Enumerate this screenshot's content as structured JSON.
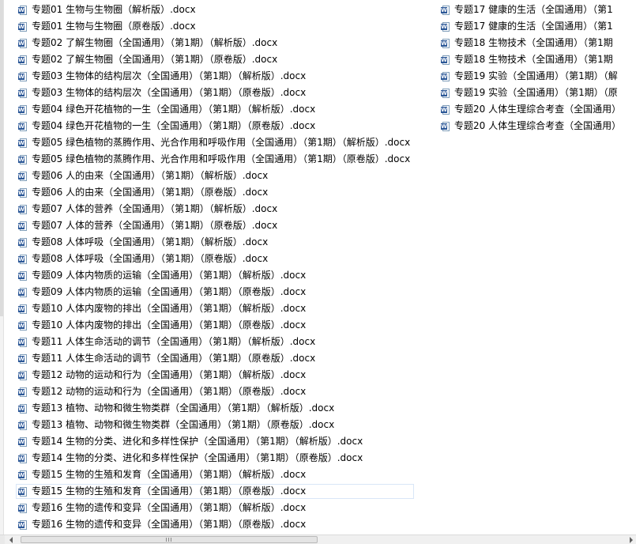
{
  "icons": {
    "file_icon": "word-doc-icon",
    "badge_letter": "W"
  },
  "colors": {
    "badge": "#2b5797",
    "selection_border": "#d9e6f7"
  },
  "selected_index": 29,
  "files_left": [
    "专题01 生物与生物圈（解析版）.docx",
    "专题01 生物与生物圈（原卷版）.docx",
    "专题02 了解生物圈（全国通用）（第1期）（解析版）.docx",
    "专题02 了解生物圈（全国通用）（第1期）（原卷版）.docx",
    "专题03 生物体的结构层次（全国通用）（第1期）（解析版）.docx",
    "专题03 生物体的结构层次（全国通用）（第1期）（原卷版）.docx",
    "专题04 绿色开花植物的一生（全国通用）（第1期）（解析版）.docx",
    "专题04 绿色开花植物的一生（全国通用）（第1期）（原卷版）.docx",
    "专题05 绿色植物的蒸腾作用、光合作用和呼吸作用（全国通用）（第1期）（解析版）.docx",
    "专题05 绿色植物的蒸腾作用、光合作用和呼吸作用（全国通用）（第1期）（原卷版）.docx",
    "专题06 人的由来（全国通用）（第1期）（解析版）.docx",
    "专题06 人的由来（全国通用）（第1期）（原卷版）.docx",
    "专题07 人体的营养（全国通用）（第1期）（解析版）.docx",
    "专题07 人体的营养（全国通用）（第1期）（原卷版）.docx",
    "专题08 人体呼吸（全国通用）（第1期）（解析版）.docx",
    "专题08 人体呼吸（全国通用）（第1期）（原卷版）.docx",
    "专题09 人体内物质的运输（全国通用）（第1期）（解析版）.docx",
    "专题09 人体内物质的运输（全国通用）（第1期）（原卷版）.docx",
    "专题10 人体内废物的排出（全国通用）（第1期）（解析版）.docx",
    "专题10 人体内废物的排出（全国通用）（第1期）（原卷版）.docx",
    "专题11 人体生命活动的调节（全国通用）（第1期）（解析版）.docx",
    "专题11 人体生命活动的调节（全国通用）（第1期）（原卷版）.docx",
    "专题12 动物的运动和行为（全国通用）（第1期）（解析版）.docx",
    "专题12 动物的运动和行为（全国通用）（第1期）（原卷版）.docx",
    "专题13 植物、动物和微生物类群（全国通用）（第1期）（解析版）.docx",
    "专题13 植物、动物和微生物类群（全国通用）（第1期）（原卷版）.docx",
    "专题14 生物的分类、进化和多样性保护（全国通用）（第1期）（解析版）.docx",
    "专题14 生物的分类、进化和多样性保护（全国通用）（第1期）（原卷版）.docx",
    "专题15 生物的生殖和发育（全国通用）（第1期）（解析版）.docx",
    "专题15 生物的生殖和发育（全国通用）（第1期）（原卷版）.docx",
    "专题16 生物的遗传和变异（全国通用）（第1期）（解析版）.docx",
    "专题16 生物的遗传和变异（全国通用）（第1期）（原卷版）.docx"
  ],
  "files_right": [
    "专题17 健康的生活（全国通用）（第1",
    "专题17 健康的生活（全国通用）（第1",
    "专题18 生物技术（全国通用）（第1期",
    "专题18 生物技术（全国通用）（第1期",
    "专题19 实验（全国通用）（第1期）（解",
    "专题19 实验（全国通用）（第1期）（原",
    "专题20 人体生理综合考查（全国通用）",
    "专题20 人体生理综合考查（全国通用）"
  ]
}
